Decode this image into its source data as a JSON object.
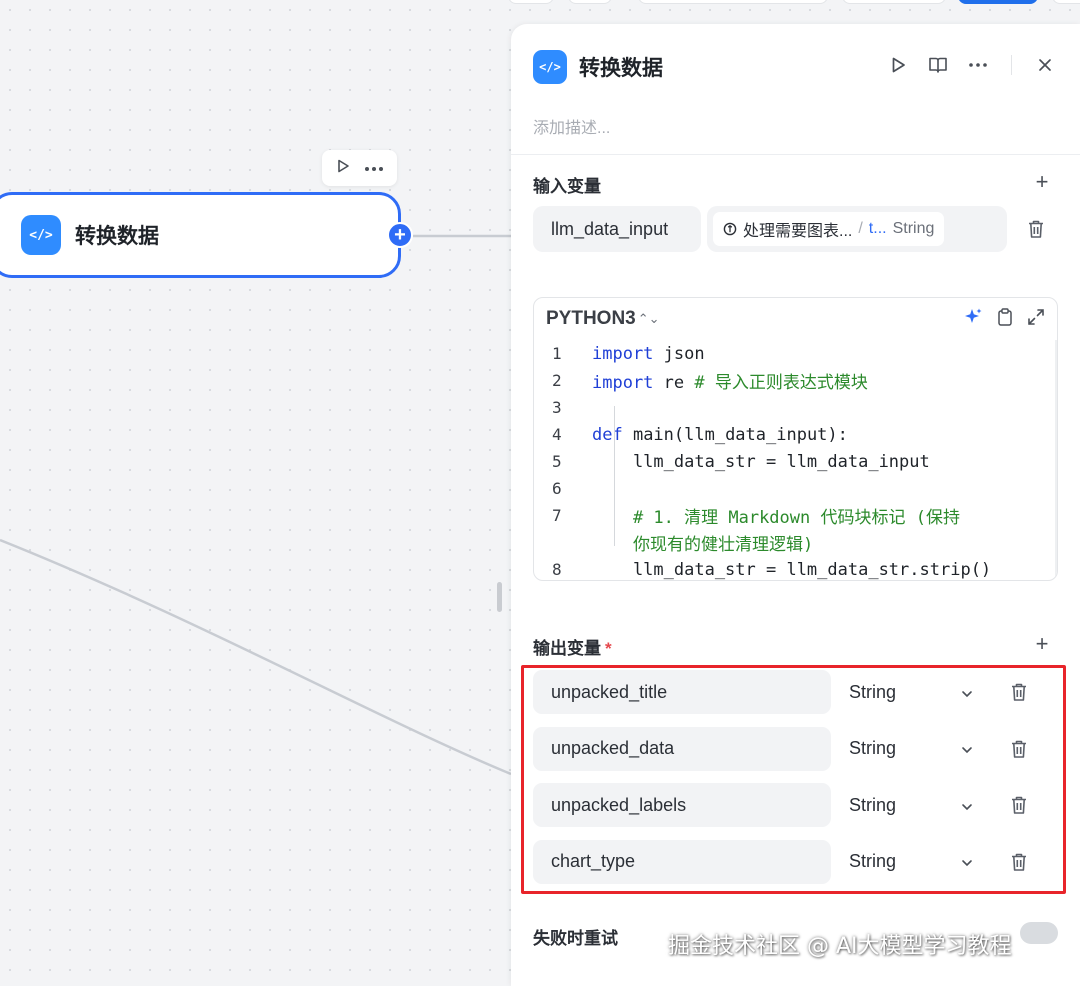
{
  "node": {
    "title": "转换数据",
    "icon": "code-icon",
    "toolbar": [
      "play-icon",
      "more-icon"
    ]
  },
  "panel": {
    "title": "转换数据",
    "description_placeholder": "添加描述...",
    "header_actions": [
      "play-icon",
      "book-icon",
      "more-icon",
      "close-icon"
    ]
  },
  "input_section": {
    "label": "输入变量",
    "variables": [
      {
        "name": "llm_data_input",
        "ref_node": "处理需要图表...",
        "ref_separator": "/",
        "ref_field": "t...",
        "ref_type": "String"
      }
    ]
  },
  "editor": {
    "language": "PYTHON3",
    "lines": [
      {
        "n": "1",
        "kw": "import",
        "rest": " json",
        "comment": ""
      },
      {
        "n": "2",
        "kw": "import",
        "rest": " re ",
        "comment": "# 导入正则表达式模块"
      },
      {
        "n": "3",
        "kw": "",
        "rest": "",
        "comment": ""
      },
      {
        "n": "4",
        "kw": "def",
        "rest": " main(llm_data_input):",
        "comment": ""
      },
      {
        "n": "5",
        "kw": "",
        "rest": "    llm_data_str = llm_data_input",
        "comment": ""
      },
      {
        "n": "6",
        "kw": "",
        "rest": "",
        "comment": ""
      },
      {
        "n": "7",
        "kw": "",
        "rest": "    ",
        "comment": "# 1. 清理 Markdown 代码块标记 (保持"
      },
      {
        "n": "",
        "kw": "",
        "rest": "    ",
        "comment": "你现有的健壮清理逻辑)"
      },
      {
        "n": "8",
        "kw": "",
        "rest": "    llm_data_str = llm_data_str.strip()",
        "comment": ""
      }
    ]
  },
  "output_section": {
    "label": "输出变量",
    "required_mark": "*",
    "variables": [
      {
        "name": "unpacked_title",
        "type": "String"
      },
      {
        "name": "unpacked_data",
        "type": "String"
      },
      {
        "name": "unpacked_labels",
        "type": "String"
      },
      {
        "name": "chart_type",
        "type": "String"
      }
    ]
  },
  "retry_section": {
    "label": "失败时重试"
  },
  "watermark": "掘金技术社区 @ AI大模型学习教程",
  "colors": {
    "accent": "#2f6cf6",
    "icon_bg": "#2f8cff",
    "highlight": "#e8242a"
  }
}
